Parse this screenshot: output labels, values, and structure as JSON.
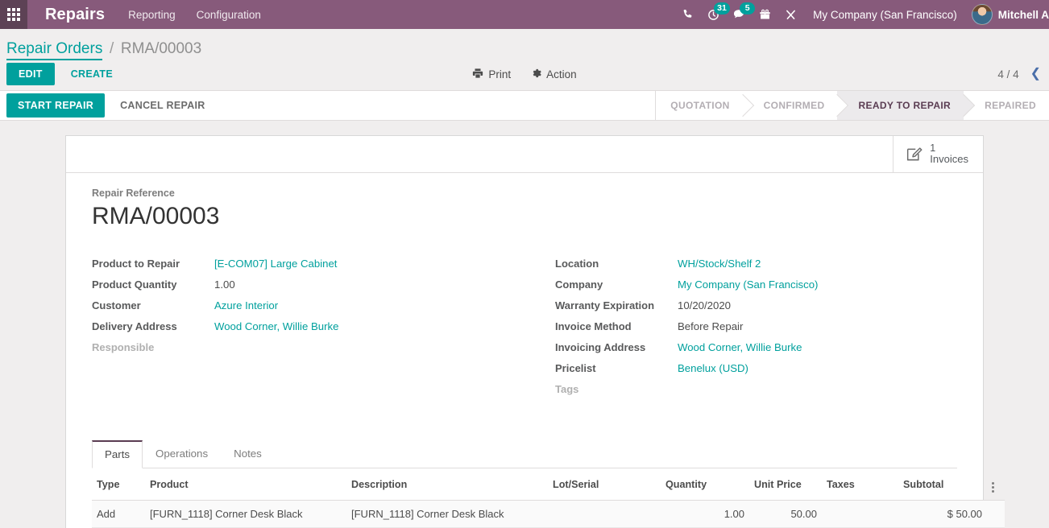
{
  "navbar": {
    "apps_icon": "apps-grid-icon",
    "brand": "Repairs",
    "menu": [
      {
        "label": "Reporting"
      },
      {
        "label": "Configuration"
      }
    ],
    "systray": [
      {
        "name": "phone-icon",
        "badge": ""
      },
      {
        "name": "activity-clock-icon",
        "badge": "31"
      },
      {
        "name": "messages-icon",
        "badge": "5"
      },
      {
        "name": "gift-icon",
        "badge": ""
      },
      {
        "name": "tools-icon",
        "badge": ""
      }
    ],
    "company": "My Company (San Francisco)",
    "user_name": "Mitchell A",
    "accent": "#875A7B",
    "badge_color": "#00A09D"
  },
  "breadcrumb": {
    "root": "Repair Orders",
    "separator": "/",
    "current": "RMA/00003"
  },
  "control_panel": {
    "edit_label": "EDIT",
    "create_label": "CREATE",
    "print_label": "Print",
    "action_label": "Action",
    "pager": "4 / 4",
    "pager_prev_icon": "chevron-left-icon"
  },
  "statusbar": {
    "start_label": "START REPAIR",
    "cancel_label": "CANCEL REPAIR",
    "stages": [
      {
        "label": "QUOTATION",
        "active": false
      },
      {
        "label": "CONFIRMED",
        "active": false
      },
      {
        "label": "READY TO REPAIR",
        "active": true
      },
      {
        "label": "REPAIRED",
        "active": false
      }
    ]
  },
  "smart_buttons": [
    {
      "icon": "invoice-pencil-icon",
      "value": "1",
      "label": "Invoices"
    }
  ],
  "record": {
    "reference_label": "Repair Reference",
    "reference_value": "RMA/00003"
  },
  "form": {
    "left": [
      {
        "label": "Product to Repair",
        "value": "[E-COM07] Large Cabinet",
        "link": true
      },
      {
        "label": "Product Quantity",
        "value": "1.00",
        "link": false
      },
      {
        "label": "Customer",
        "value": "Azure Interior",
        "link": true
      },
      {
        "label": "Delivery Address",
        "value": "Wood Corner, Willie Burke",
        "link": true
      },
      {
        "label": "Responsible",
        "value": "",
        "link": false,
        "muted": true
      }
    ],
    "right": [
      {
        "label": "Location",
        "value": "WH/Stock/Shelf 2",
        "link": true
      },
      {
        "label": "Company",
        "value": "My Company (San Francisco)",
        "link": true
      },
      {
        "label": "Warranty Expiration",
        "value": "10/20/2020",
        "link": false
      },
      {
        "label": "Invoice Method",
        "value": "Before Repair",
        "link": false
      },
      {
        "label": "Invoicing Address",
        "value": "Wood Corner, Willie Burke",
        "link": true
      },
      {
        "label": "Pricelist",
        "value": "Benelux (USD)",
        "link": true
      },
      {
        "label": "Tags",
        "value": "",
        "link": false,
        "muted": true
      }
    ]
  },
  "notebook": {
    "tabs": [
      {
        "label": "Parts",
        "active": true
      },
      {
        "label": "Operations",
        "active": false
      },
      {
        "label": "Notes",
        "active": false
      }
    ],
    "columns": [
      "Type",
      "Product",
      "Description",
      "Lot/Serial",
      "Quantity",
      "Unit Price",
      "Taxes",
      "Subtotal"
    ],
    "rows": [
      {
        "type": "Add",
        "product": "[FURN_1118] Corner Desk Black",
        "description": "[FURN_1118] Corner Desk Black",
        "lot_serial": "",
        "quantity": "1.00",
        "unit_price": "50.00",
        "taxes": "",
        "subtotal": "$ 50.00"
      }
    ],
    "options_icon": "column-options-icon"
  }
}
